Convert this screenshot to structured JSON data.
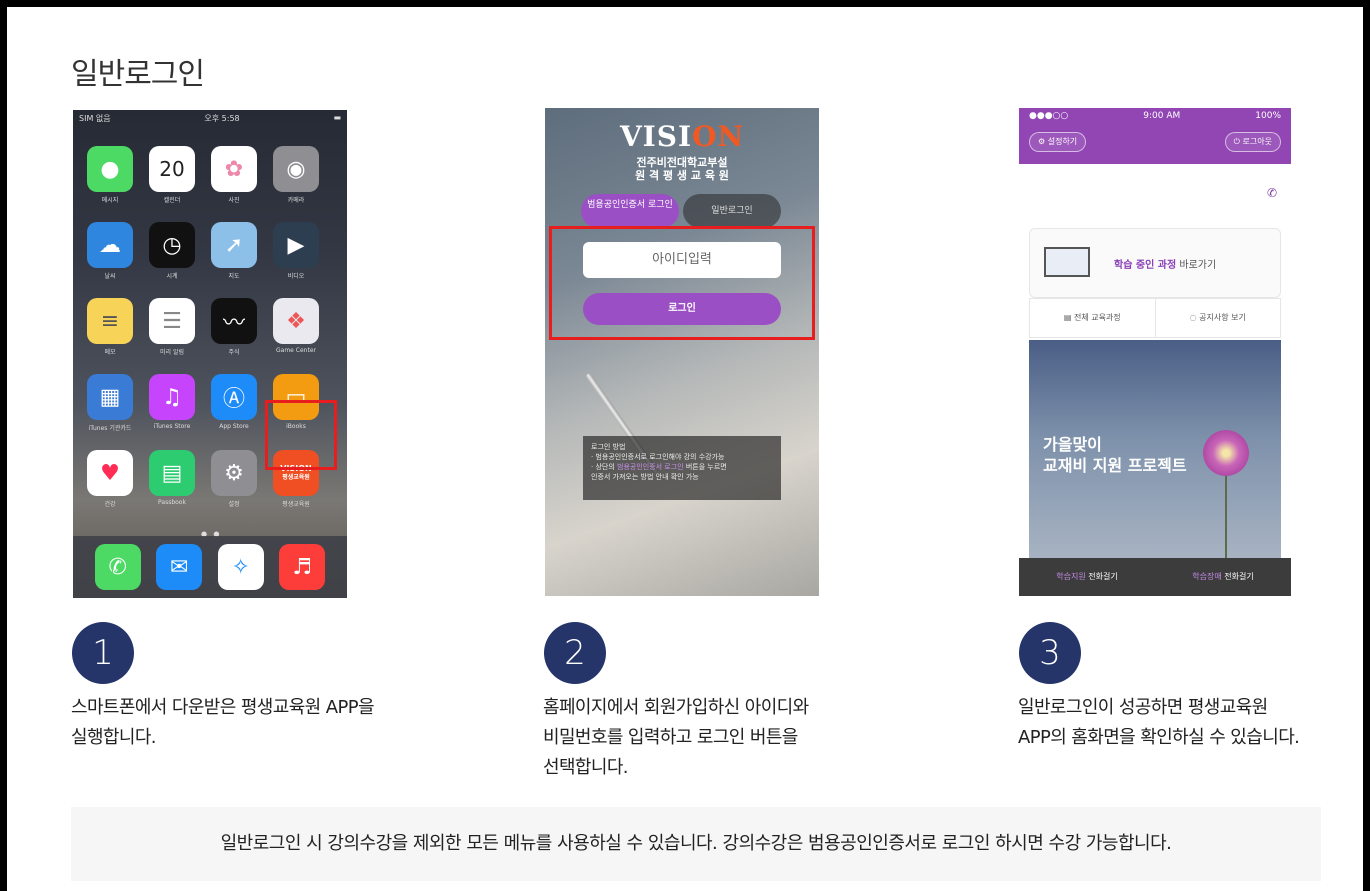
{
  "page": {
    "title": "일반로그인",
    "notice": "일반로그인 시 강의수강을 제외한 모든 메뉴를 사용하실 수 있습니다. 강의수강은 범용공인인증서로 로그인 하시면 수강 가능합니다."
  },
  "steps": [
    {
      "number": "1",
      "line1": "스마트폰에서 다운받은 평생교육원 APP을",
      "line2": "실행합니다.",
      "line3": ""
    },
    {
      "number": "2",
      "line1": "홈페이지에서 회원가입하신 아이디와",
      "line2": "비밀번호를 입력하고 로그인 버튼을",
      "line3": "선택합니다."
    },
    {
      "number": "3",
      "line1": "일반로그인이 성공하면 평생교육원",
      "line2": "APP의 홈화면을 확인하실 수 있습니다.",
      "line3": ""
    }
  ],
  "phone1": {
    "status_left": "SIM 없음",
    "status_time": "오후 5:58",
    "calendar_day": "20",
    "vision_app_line1": "VISION",
    "vision_app_line2": "평생교육원",
    "vision_app_label": "평생교육원",
    "apps": [
      "메시지",
      "캘린더",
      "사진",
      "카메라",
      "날씨",
      "시계",
      "지도",
      "비디오",
      "메모",
      "미리 알림",
      "주식",
      "Game Center",
      "iTunes 기관카드",
      "iTunes Store",
      "App Store",
      "iBooks",
      "건강",
      "Passbook",
      "설정"
    ],
    "dock": [
      "전화",
      "Mail",
      "Safari",
      "음악"
    ]
  },
  "phone2": {
    "logo_main": "VISI",
    "logo_accent": "ON",
    "subtitle_line1": "전주비전대학교부설",
    "subtitle_line2": "원 격 평 생 교 육 원",
    "tab_cert": "범용공인인증서 로그인",
    "tab_general": "일반로그인",
    "id_placeholder": "아이디입력",
    "login_button": "로그인",
    "info_title": "로그인 방법",
    "info_line1": "· 범용공인인증서로 로그인해야 강의 수강가능",
    "info_line2_pre": "· 상단의 ",
    "info_line2_hl": "범용공인인증서 로그인",
    "info_line2_post": " 버튼을 누르면",
    "info_line3": "인증서 가져오는 방법 안내 확인 가능"
  },
  "phone3": {
    "status_carrier": "●●●○○",
    "status_time": "9:00 AM",
    "status_battery": "100%",
    "settings_btn": "설정하기",
    "logout_btn": "로그아웃",
    "card_strong": "학습 중인 과정",
    "card_rest": " 바로가기",
    "menu_courses": "전체 교육과정",
    "menu_notice": "공지사항 보기",
    "banner_line1": "가을맞이",
    "banner_line2": "교재비 지원 프로젝트",
    "footer_left_hl": "학습지원",
    "footer_left": " 전화걸기",
    "footer_right_hl": "학습장애",
    "footer_right": " 전화걸기"
  },
  "colors": {
    "step_circle": "#25356a",
    "highlight_border": "#e81d1d",
    "purple": "#9b4fc5",
    "vision_orange": "#f04e23"
  }
}
